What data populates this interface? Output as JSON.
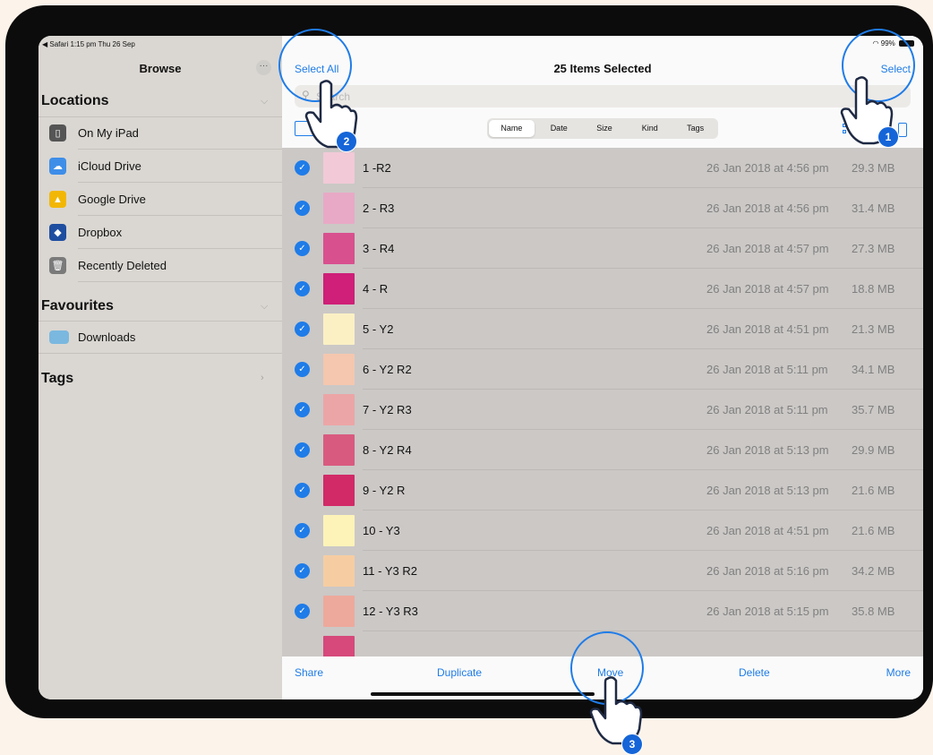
{
  "status_bar": {
    "left": "◀ Safari  1:15 pm  Thu 26 Sep",
    "right": "99%"
  },
  "sidebar": {
    "title": "Browse",
    "more_glyph": "···",
    "locations_title": "Locations",
    "locations": [
      {
        "label": "On My iPad",
        "icon": "ipad-icon",
        "color": "#555555"
      },
      {
        "label": "iCloud Drive",
        "icon": "icloud-icon",
        "color": "#3e8ee8"
      },
      {
        "label": "Google Drive",
        "icon": "google-drive-icon",
        "color": "#f2b705"
      },
      {
        "label": "Dropbox",
        "icon": "dropbox-icon",
        "color": "#1e4ea0"
      },
      {
        "label": "Recently Deleted",
        "icon": "trash-icon",
        "color": "#7a7a7a"
      }
    ],
    "favourites_title": "Favourites",
    "favourites": [
      {
        "label": "Downloads",
        "icon": "downloads-folder-icon",
        "color": "#7ab8e0"
      }
    ],
    "tags_title": "Tags"
  },
  "nav": {
    "select_all": "Select All",
    "title": "25 Items Selected",
    "select": "Select"
  },
  "search": {
    "placeholder": "Search"
  },
  "sort_tabs": [
    "Name",
    "Date",
    "Size",
    "Kind",
    "Tags"
  ],
  "files": [
    {
      "name": "1 -R2",
      "date": "26 Jan 2018 at 4:56 pm",
      "size": "29.3 MB",
      "color": "#f2c9d7"
    },
    {
      "name": "2 - R3",
      "date": "26 Jan 2018 at 4:56 pm",
      "size": "31.4 MB",
      "color": "#e8a9c6"
    },
    {
      "name": "3 - R4",
      "date": "26 Jan 2018 at 4:57 pm",
      "size": "27.3 MB",
      "color": "#d9508f"
    },
    {
      "name": "4 - R",
      "date": "26 Jan 2018 at 4:57 pm",
      "size": "18.8 MB",
      "color": "#cf1f78"
    },
    {
      "name": "5 - Y2",
      "date": "26 Jan 2018 at 4:51 pm",
      "size": "21.3 MB",
      "color": "#fbf0c4"
    },
    {
      "name": "6 - Y2 R2",
      "date": "26 Jan 2018 at 5:11 pm",
      "size": "34.1 MB",
      "color": "#f4c7ae"
    },
    {
      "name": "7 - Y2 R3",
      "date": "26 Jan 2018 at 5:11 pm",
      "size": "35.7 MB",
      "color": "#eca5a6"
    },
    {
      "name": "8 - Y2 R4",
      "date": "26 Jan 2018 at 5:13 pm",
      "size": "29.9 MB",
      "color": "#d95a7f"
    },
    {
      "name": "9 - Y2 R",
      "date": "26 Jan 2018 at 5:13 pm",
      "size": "21.6 MB",
      "color": "#d12a67"
    },
    {
      "name": "10 - Y3",
      "date": "26 Jan 2018 at 4:51 pm",
      "size": "21.6 MB",
      "color": "#fdf3b8"
    },
    {
      "name": "11 - Y3 R2",
      "date": "26 Jan 2018 at 5:16 pm",
      "size": "34.2 MB",
      "color": "#f6cda2"
    },
    {
      "name": "12 - Y3 R3",
      "date": "26 Jan 2018 at 5:15 pm",
      "size": "35.8 MB",
      "color": "#eda99c"
    },
    {
      "name": "",
      "date": "",
      "size": "",
      "color": "#d6497a"
    }
  ],
  "toolbar": {
    "share": "Share",
    "duplicate": "Duplicate",
    "move": "Move",
    "delete": "Delete",
    "more": "More"
  },
  "callouts": [
    "1",
    "2",
    "3"
  ],
  "colors": {
    "accent": "#1f7ce8",
    "background": "#fcf3ea",
    "selected_list": "#cbc8c6"
  }
}
